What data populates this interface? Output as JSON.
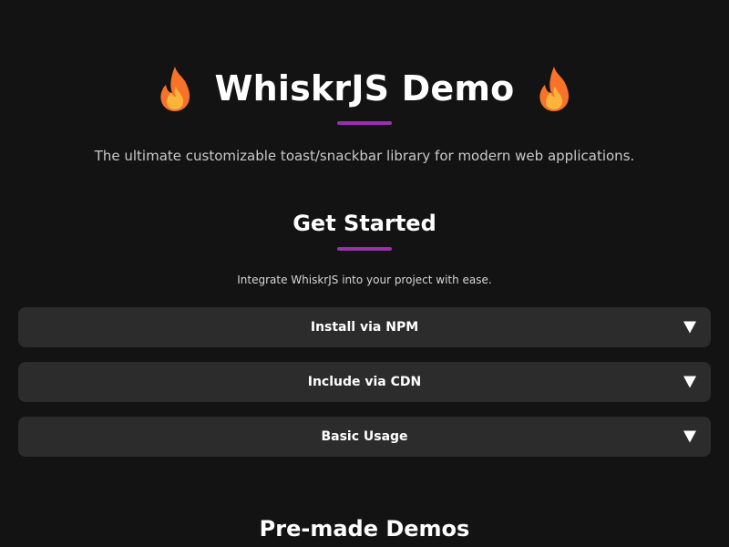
{
  "hero": {
    "title": "WhiskrJS Demo",
    "left_icon": "fire-icon",
    "right_icon": "fire-icon",
    "subtitle": "The ultimate customizable toast/snackbar library for modern web applications."
  },
  "get_started": {
    "title": "Get Started",
    "description": "Integrate WhiskrJS into your project with ease.",
    "items": [
      {
        "label": "Install via NPM",
        "icon": "triangle-down-icon"
      },
      {
        "label": "Include via CDN",
        "icon": "triangle-down-icon"
      },
      {
        "label": "Basic Usage",
        "icon": "triangle-down-icon"
      }
    ]
  },
  "demos": {
    "title": "Pre-made Demos"
  },
  "colors": {
    "background": "#141314",
    "accent": "#9b2fae",
    "card": "#2d2c2d",
    "flame_outer": "#f7732a",
    "flame_inner": "#fdb43b"
  }
}
